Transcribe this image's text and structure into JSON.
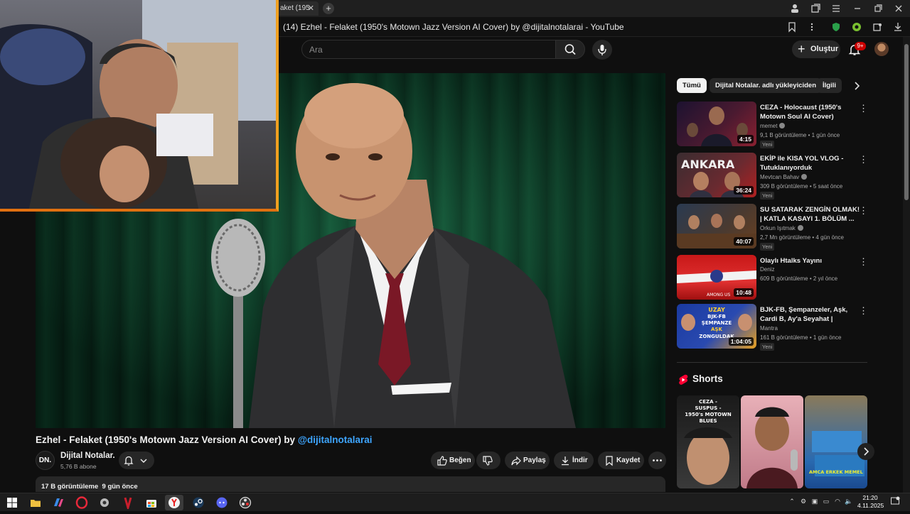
{
  "browser": {
    "tab_label": "aket (195",
    "tab_close": "✕",
    "new_tab": "+",
    "page_title": "(14) Ezhel - Felaket (1950's Motown Jazz Version AI Cover) by @dijitalnotalarai - YouTube"
  },
  "youtube_header": {
    "search_placeholder": "Ara",
    "create_label": "Oluştur",
    "notification_count": "9+"
  },
  "video": {
    "title_main": "Ezhel - Felaket (1950's Motown Jazz Version AI Cover) by ",
    "title_handle": "@dijitalnotalarai",
    "channel_initials": "DN.",
    "channel_name": "Dijital Notalar.",
    "subscribers": "5,76 B abone",
    "like_label": "Beğen",
    "share_label": "Paylaş",
    "download_label": "İndir",
    "save_label": "Kaydet",
    "views": "17 B görüntüleme",
    "age": "9 gün önce"
  },
  "sidebar": {
    "chips": [
      "Tümü",
      "Dijital Notalar. adlı yükleyiciden",
      "İlgili"
    ],
    "recommendations": [
      {
        "title": "CEZA - Holocaust (1950's Motown Soul AI Cover)",
        "channel": "memet",
        "verified": true,
        "views": "9,1 B görüntüleme",
        "age": "1 gün önce",
        "badge": "Yeni",
        "duration": "4:15",
        "colors": [
          "#1c1230",
          "#8a2030"
        ]
      },
      {
        "title": "EKİP ile KISA YOL VLOG - Tutuklanıyorduk",
        "channel": "Mevtcan Bahav",
        "verified": true,
        "views": "309 B görüntüleme",
        "age": "5 saat önce",
        "badge": "Yeni",
        "duration": "36:24",
        "colors": [
          "#3a2c30",
          "#b02020"
        ]
      },
      {
        "title": "SU SATARAK ZENGİN OLMAK! | KATLA KASAYI 1. BÖLÜM ...",
        "channel": "Orkun Işıtmak",
        "verified": true,
        "views": "2,7 Mn görüntüleme",
        "age": "4 gün önce",
        "badge": "Yeni",
        "duration": "40:07",
        "colors": [
          "#2a3a50",
          "#6a4020"
        ]
      },
      {
        "title": "Olaylı Htalks Yayını",
        "channel": "Deniz",
        "verified": false,
        "views": "609 B görüntüleme",
        "age": "2 yıl önce",
        "badge": "",
        "duration": "10:48",
        "colors": [
          "#c81818",
          "#e8e8e8"
        ]
      },
      {
        "title": "BJK-FB, Şempanzeler, Aşk, Cardi B, Ay'a Seyahat | Harman...",
        "channel": "Mantra",
        "verified": false,
        "views": "161 B görüntüleme",
        "age": "1 gün önce",
        "badge": "Yeni",
        "duration": "1:04:05",
        "colors": [
          "#1a3aa0",
          "#e8a020"
        ]
      }
    ],
    "rec4_overlay": "AMONG US",
    "rec5_overlay": [
      "UZAY",
      "BJK-FB",
      "ŞEMPANZE",
      "AŞK",
      "ZONGULDAK"
    ],
    "shorts_title": "Shorts",
    "short1_caption": [
      "CEZA -",
      "SUSPUS -",
      "1950's MOTOWN",
      "BLUES"
    ],
    "short3_caption": "AMCA ERKEK MEMEL"
  },
  "taskbar": {
    "time": "21:20",
    "date": "4.11.2025"
  },
  "colors": {
    "background": "#0f0f0f",
    "surface": "#272727",
    "link": "#3ea6ff",
    "accent_red": "#ff0033",
    "webcam_border": "#f0a020"
  }
}
